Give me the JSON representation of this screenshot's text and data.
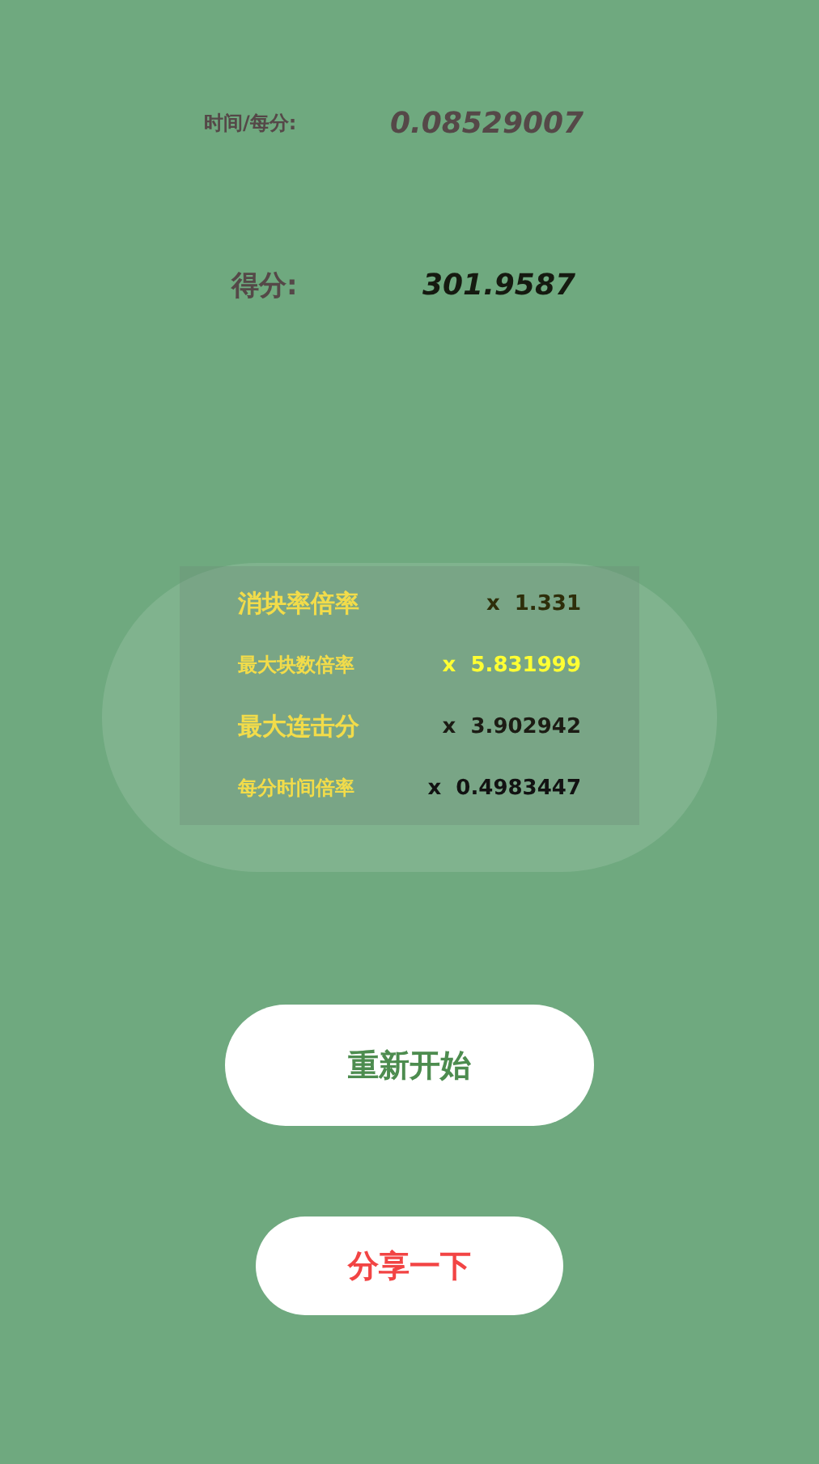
{
  "stats": [
    {
      "kind": "small",
      "label": "时间/每分:",
      "value": "0.08529007"
    },
    {
      "kind": "large",
      "label": "得分:",
      "value": "301.9587"
    }
  ],
  "multipliers": [
    {
      "kind": "large",
      "label": "消块率倍率",
      "value": "x  1.331",
      "color": "#2e2e0a"
    },
    {
      "kind": "small",
      "label": "最大块数倍率",
      "value": "x  5.831999",
      "color": "#ffff33"
    },
    {
      "kind": "large",
      "label": "最大连击分",
      "value": "x  3.902942",
      "color": "#1c1c14"
    },
    {
      "kind": "small",
      "label": "每分时间倍率",
      "value": "x  0.4983447",
      "color": "#121212"
    }
  ],
  "buttons": [
    {
      "kind": "restart",
      "label": "重新开始"
    },
    {
      "kind": "share",
      "label": "分享一下"
    }
  ]
}
